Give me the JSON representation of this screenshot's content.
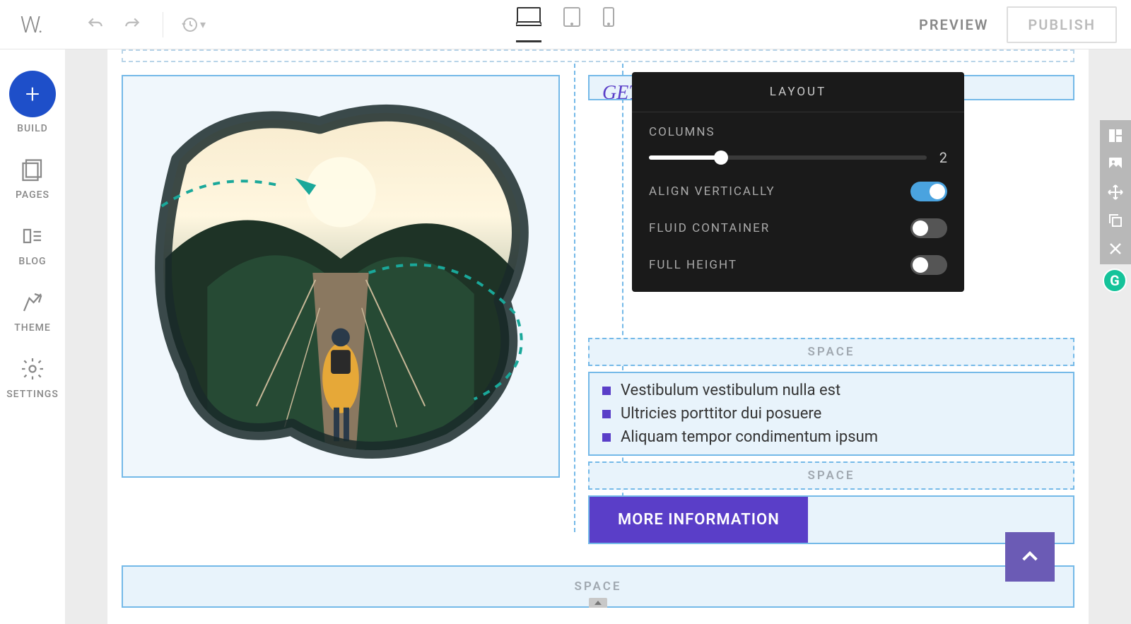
{
  "topbar": {
    "preview": "PREVIEW",
    "publish": "PUBLISH"
  },
  "sidebar": {
    "build": "BUILD",
    "pages": "PAGES",
    "blog": "BLOG",
    "theme": "THEME",
    "settings": "SETTINGS"
  },
  "canvas": {
    "space_label": "SPACE",
    "heading": "GET TO KNOW ME",
    "bullets": [
      "Vestibulum vestibulum nulla est",
      "Ultricies porttitor dui posuere",
      "Aliquam tempor condimentum ipsum"
    ],
    "more_button": "MORE INFORMATION"
  },
  "popover": {
    "title": "LAYOUT",
    "columns_label": "COLUMNS",
    "columns_value": "2",
    "align_vertically": "ALIGN VERTICALLY",
    "fluid_container": "FLUID CONTAINER",
    "full_height": "FULL HEIGHT"
  }
}
